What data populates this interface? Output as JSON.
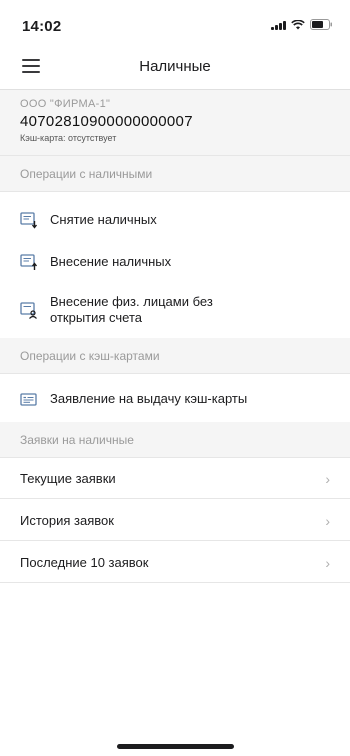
{
  "status_bar": {
    "time": "14:02"
  },
  "nav": {
    "title": "Наличные",
    "menu_icon": "hamburger-menu-icon"
  },
  "account": {
    "org_name": "ООО \"ФИРМА-1\"",
    "number": "40702810900000000007",
    "cash_card": "Кэш-карта: отсутствует"
  },
  "sections": {
    "cash_ops": {
      "title": "Операции с наличными",
      "items": [
        {
          "label": "Снятие наличных",
          "icon": "cash-withdrawal-icon"
        },
        {
          "label": "Внесение наличных",
          "icon": "cash-deposit-icon"
        },
        {
          "label": "Внесение физ. лицами без",
          "label_line2": "открытия счета",
          "icon": "individual-deposit-icon"
        }
      ]
    },
    "card_ops": {
      "title": "Операции с кэш-картами",
      "items": [
        {
          "label": "Заявление на выдачу кэш-карты",
          "icon": "card-application-icon"
        }
      ]
    },
    "requests": {
      "title": "Заявки на наличные",
      "items": [
        {
          "label": "Текущие заявки",
          "chevron": "›"
        },
        {
          "label": "История заявок",
          "chevron": "›"
        },
        {
          "label": "Последние 10 заявок",
          "chevron": "›"
        }
      ]
    }
  },
  "colors": {
    "accent": "#3a7bd5",
    "section_bg": "#f5f5f5",
    "muted_text": "#9a9a9a"
  }
}
